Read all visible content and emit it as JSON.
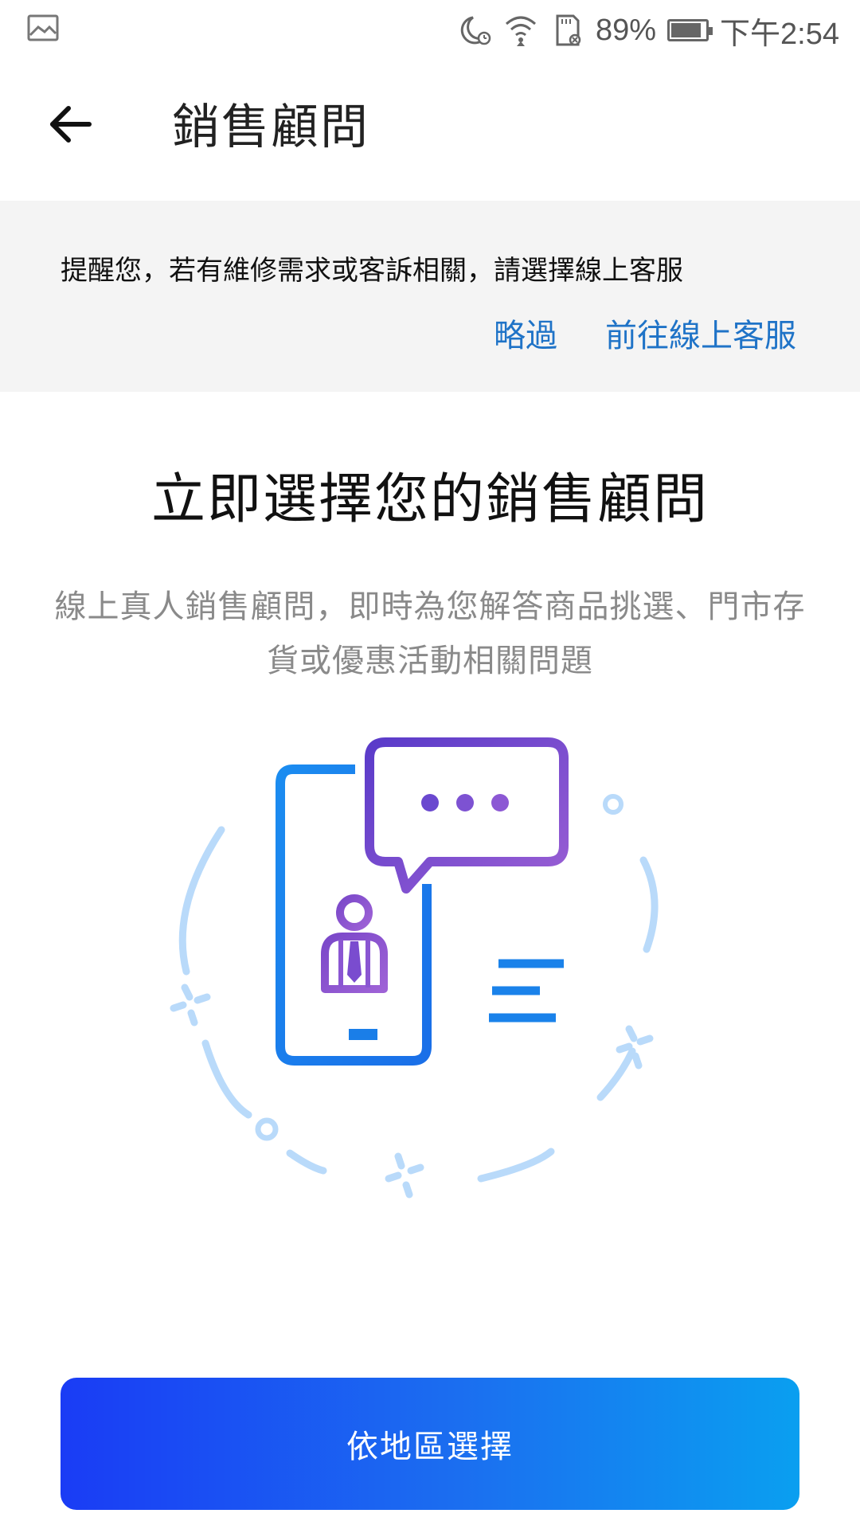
{
  "status_bar": {
    "left_icon": "image-icon",
    "icons": [
      "moon-alarm-icon",
      "wifi-icon",
      "sd-card-icon"
    ],
    "battery_percent_text": "89%",
    "battery_level": 0.89,
    "time": "下午2:54"
  },
  "app_bar": {
    "back_icon": "arrow-left-icon",
    "title": "銷售顧問"
  },
  "banner": {
    "message": "提醒您，若有維修需求或客訴相關，請選擇線上客服",
    "skip_label": "略過",
    "online_service_label": "前往線上客服"
  },
  "hero": {
    "title": "立即選擇您的銷售顧問",
    "subtitle": "線上真人銷售顧問，即時為您解答商品挑選、門市存貨或優惠活動相關問題",
    "illustration": "phone-chat-consultant-icon"
  },
  "cta": {
    "label": "依地區選擇"
  },
  "colors": {
    "link": "#1f73c7",
    "banner_bg": "#f4f4f4",
    "cta_start": "#1a3cf5",
    "cta_end": "#0a9ff0"
  }
}
